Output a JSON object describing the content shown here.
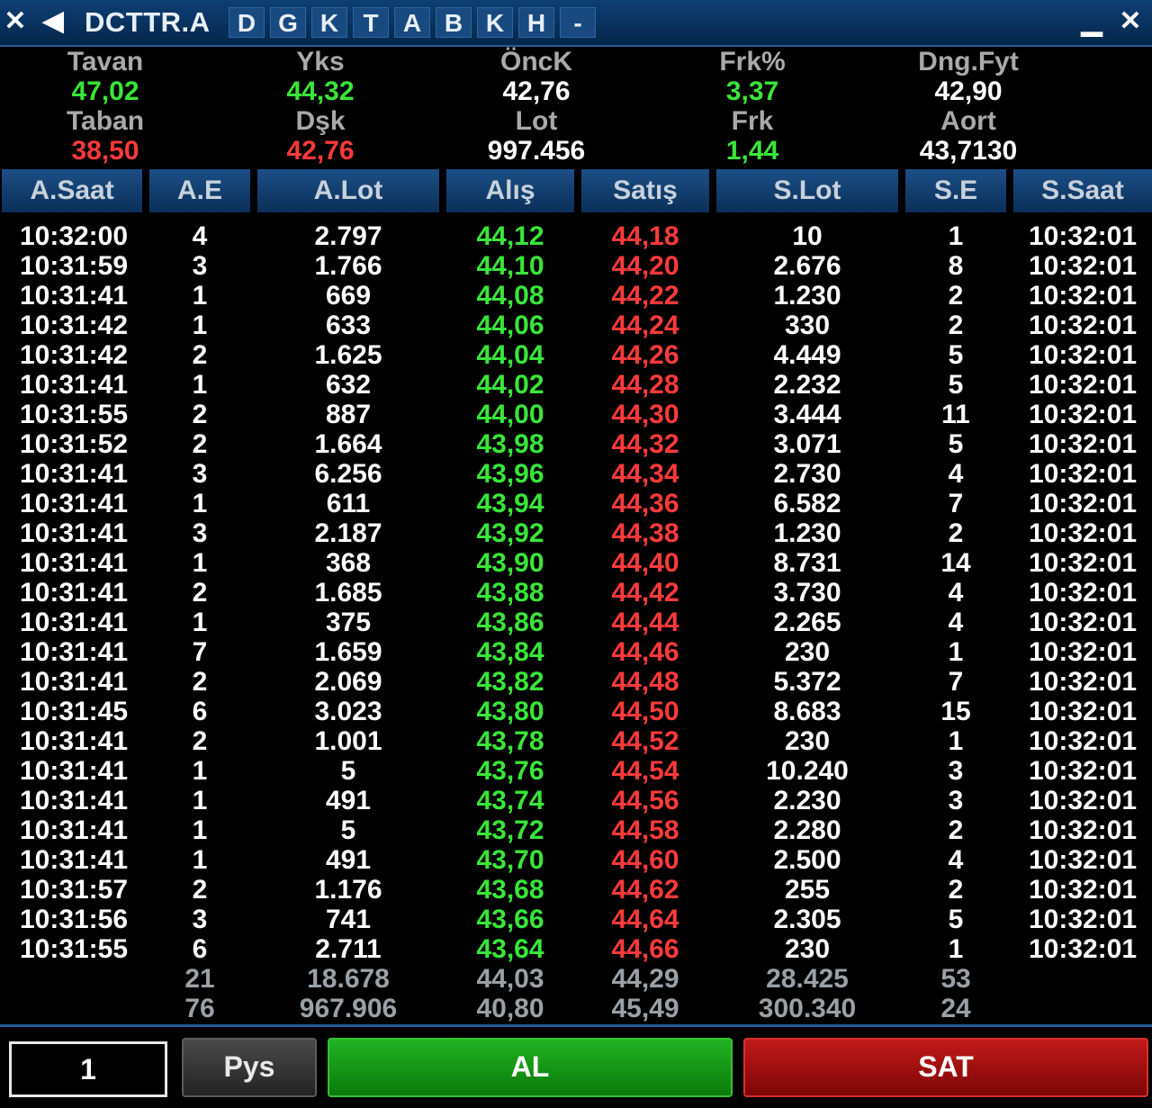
{
  "window": {
    "close_icon": "x-icon",
    "back_icon": "arrow-left-icon",
    "symbol": "DCTTR.A",
    "letters": [
      "D",
      "G",
      "K",
      "T",
      "A",
      "B",
      "K",
      "H",
      "-"
    ]
  },
  "summary": {
    "tavan_label": "Tavan",
    "tavan": "47,02",
    "taban_label": "Taban",
    "taban": "38,50",
    "yks_label": "Yks",
    "yks": "44,32",
    "dsk_label": "Dşk",
    "dsk": "42,76",
    "onck_label": "ÖncK",
    "onck": "42,76",
    "lot_label": "Lot",
    "lot": "997.456",
    "frkp_label": "Frk%",
    "frkp": "3,37",
    "frk_label": "Frk",
    "frk": "1,44",
    "dng_label": "Dng.Fyt",
    "dng": "42,90",
    "aort_label": "Aort",
    "aort": "43,7130"
  },
  "columns": [
    "A.Saat",
    "A.E",
    "A.Lot",
    "Alış",
    "Satış",
    "S.Lot",
    "S.E",
    "S.Saat"
  ],
  "rows": [
    {
      "a_saat": "10:32:00",
      "a_e": "4",
      "a_lot": "2.797",
      "alis": "44,12",
      "satis": "44,18",
      "s_lot": "10",
      "s_e": "1",
      "s_saat": "10:32:01"
    },
    {
      "a_saat": "10:31:59",
      "a_e": "3",
      "a_lot": "1.766",
      "alis": "44,10",
      "satis": "44,20",
      "s_lot": "2.676",
      "s_e": "8",
      "s_saat": "10:32:01"
    },
    {
      "a_saat": "10:31:41",
      "a_e": "1",
      "a_lot": "669",
      "alis": "44,08",
      "satis": "44,22",
      "s_lot": "1.230",
      "s_e": "2",
      "s_saat": "10:32:01"
    },
    {
      "a_saat": "10:31:42",
      "a_e": "1",
      "a_lot": "633",
      "alis": "44,06",
      "satis": "44,24",
      "s_lot": "330",
      "s_e": "2",
      "s_saat": "10:32:01"
    },
    {
      "a_saat": "10:31:42",
      "a_e": "2",
      "a_lot": "1.625",
      "alis": "44,04",
      "satis": "44,26",
      "s_lot": "4.449",
      "s_e": "5",
      "s_saat": "10:32:01"
    },
    {
      "a_saat": "10:31:41",
      "a_e": "1",
      "a_lot": "632",
      "alis": "44,02",
      "satis": "44,28",
      "s_lot": "2.232",
      "s_e": "5",
      "s_saat": "10:32:01"
    },
    {
      "a_saat": "10:31:55",
      "a_e": "2",
      "a_lot": "887",
      "alis": "44,00",
      "satis": "44,30",
      "s_lot": "3.444",
      "s_e": "11",
      "s_saat": "10:32:01"
    },
    {
      "a_saat": "10:31:52",
      "a_e": "2",
      "a_lot": "1.664",
      "alis": "43,98",
      "satis": "44,32",
      "s_lot": "3.071",
      "s_e": "5",
      "s_saat": "10:32:01"
    },
    {
      "a_saat": "10:31:41",
      "a_e": "3",
      "a_lot": "6.256",
      "alis": "43,96",
      "satis": "44,34",
      "s_lot": "2.730",
      "s_e": "4",
      "s_saat": "10:32:01"
    },
    {
      "a_saat": "10:31:41",
      "a_e": "1",
      "a_lot": "611",
      "alis": "43,94",
      "satis": "44,36",
      "s_lot": "6.582",
      "s_e": "7",
      "s_saat": "10:32:01"
    },
    {
      "a_saat": "10:31:41",
      "a_e": "3",
      "a_lot": "2.187",
      "alis": "43,92",
      "satis": "44,38",
      "s_lot": "1.230",
      "s_e": "2",
      "s_saat": "10:32:01"
    },
    {
      "a_saat": "10:31:41",
      "a_e": "1",
      "a_lot": "368",
      "alis": "43,90",
      "satis": "44,40",
      "s_lot": "8.731",
      "s_e": "14",
      "s_saat": "10:32:01"
    },
    {
      "a_saat": "10:31:41",
      "a_e": "2",
      "a_lot": "1.685",
      "alis": "43,88",
      "satis": "44,42",
      "s_lot": "3.730",
      "s_e": "4",
      "s_saat": "10:32:01"
    },
    {
      "a_saat": "10:31:41",
      "a_e": "1",
      "a_lot": "375",
      "alis": "43,86",
      "satis": "44,44",
      "s_lot": "2.265",
      "s_e": "4",
      "s_saat": "10:32:01"
    },
    {
      "a_saat": "10:31:41",
      "a_e": "7",
      "a_lot": "1.659",
      "alis": "43,84",
      "satis": "44,46",
      "s_lot": "230",
      "s_e": "1",
      "s_saat": "10:32:01"
    },
    {
      "a_saat": "10:31:41",
      "a_e": "2",
      "a_lot": "2.069",
      "alis": "43,82",
      "satis": "44,48",
      "s_lot": "5.372",
      "s_e": "7",
      "s_saat": "10:32:01"
    },
    {
      "a_saat": "10:31:45",
      "a_e": "6",
      "a_lot": "3.023",
      "alis": "43,80",
      "satis": "44,50",
      "s_lot": "8.683",
      "s_e": "15",
      "s_saat": "10:32:01"
    },
    {
      "a_saat": "10:31:41",
      "a_e": "2",
      "a_lot": "1.001",
      "alis": "43,78",
      "satis": "44,52",
      "s_lot": "230",
      "s_e": "1",
      "s_saat": "10:32:01"
    },
    {
      "a_saat": "10:31:41",
      "a_e": "1",
      "a_lot": "5",
      "alis": "43,76",
      "satis": "44,54",
      "s_lot": "10.240",
      "s_e": "3",
      "s_saat": "10:32:01"
    },
    {
      "a_saat": "10:31:41",
      "a_e": "1",
      "a_lot": "491",
      "alis": "43,74",
      "satis": "44,56",
      "s_lot": "2.230",
      "s_e": "3",
      "s_saat": "10:32:01"
    },
    {
      "a_saat": "10:31:41",
      "a_e": "1",
      "a_lot": "5",
      "alis": "43,72",
      "satis": "44,58",
      "s_lot": "2.280",
      "s_e": "2",
      "s_saat": "10:32:01"
    },
    {
      "a_saat": "10:31:41",
      "a_e": "1",
      "a_lot": "491",
      "alis": "43,70",
      "satis": "44,60",
      "s_lot": "2.500",
      "s_e": "4",
      "s_saat": "10:32:01"
    },
    {
      "a_saat": "10:31:57",
      "a_e": "2",
      "a_lot": "1.176",
      "alis": "43,68",
      "satis": "44,62",
      "s_lot": "255",
      "s_e": "2",
      "s_saat": "10:32:01"
    },
    {
      "a_saat": "10:31:56",
      "a_e": "3",
      "a_lot": "741",
      "alis": "43,66",
      "satis": "44,64",
      "s_lot": "2.305",
      "s_e": "5",
      "s_saat": "10:32:01"
    },
    {
      "a_saat": "10:31:55",
      "a_e": "6",
      "a_lot": "2.711",
      "alis": "43,64",
      "satis": "44,66",
      "s_lot": "230",
      "s_e": "1",
      "s_saat": "10:32:01"
    }
  ],
  "totals": [
    {
      "a_e": "21",
      "a_lot": "18.678",
      "alis": "44,03",
      "satis": "44,29",
      "s_lot": "28.425",
      "s_e": "53"
    },
    {
      "a_e": "76",
      "a_lot": "967.906",
      "alis": "40,80",
      "satis": "45,49",
      "s_lot": "300.340",
      "s_e": "24"
    }
  ],
  "bottom": {
    "quantity": "1",
    "pys_label": "Pys",
    "buy_label": "AL",
    "sell_label": "SAT"
  },
  "colors": {
    "bid": "#39e639",
    "ask": "#ff3a3a",
    "buy_button": "#129a12",
    "sell_button": "#a80f0f",
    "header": "#12406f"
  }
}
